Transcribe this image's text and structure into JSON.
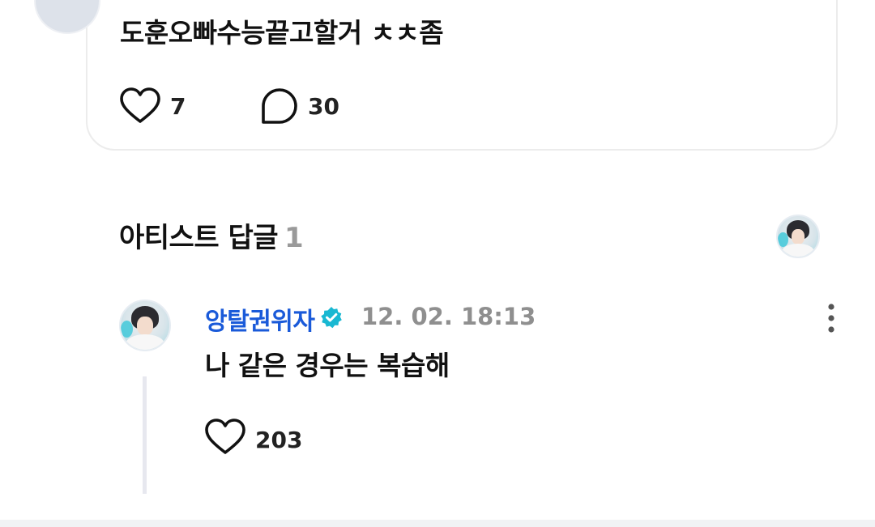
{
  "post": {
    "text": "도훈오빠수능끝고할거 ㅊㅊ좀",
    "like_count": "7",
    "comment_count": "30",
    "like_icon": "heart-outline-icon",
    "comment_icon": "speech-bubble-icon"
  },
  "artist_replies": {
    "title": "아티스트 답글",
    "count": "1"
  },
  "reply": {
    "author": "앙탈권위자",
    "verified_icon": "verified-badge-icon",
    "verified_color": "#19b8d2",
    "time": "12. 02. 18:13",
    "text": "나 같은 경우는 복습해",
    "like_count": "203"
  },
  "colors": {
    "author": "#1a5ad9",
    "muted": "#8f8f8f",
    "card_border": "#ececec"
  }
}
